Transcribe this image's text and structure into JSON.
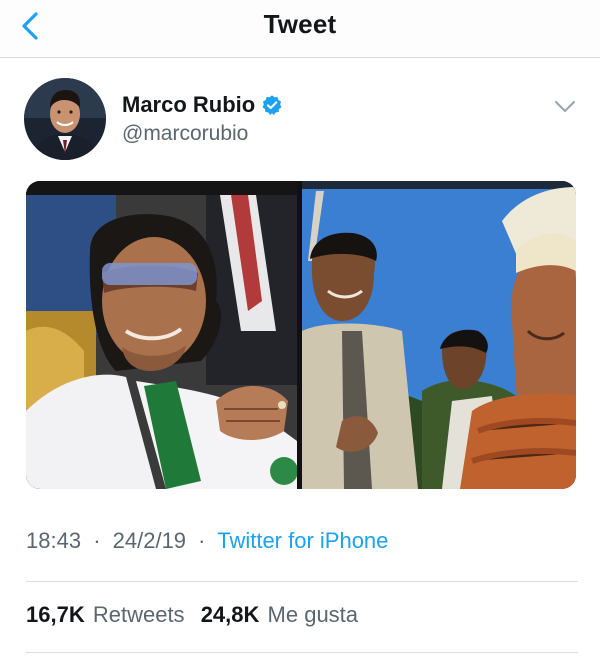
{
  "header": {
    "title": "Tweet",
    "back_icon": "chevron-left-icon",
    "accent": "#1da1f2"
  },
  "author": {
    "display_name": "Marco Rubio",
    "handle": "@marcorubio",
    "verified": true,
    "verified_color": "#1da1f2"
  },
  "tweet": {
    "time": "18:43",
    "date": "24/2/19",
    "separator": "·",
    "source": "Twitter for iPhone",
    "retweets_count": "16,7K",
    "retweets_label": "Retweets",
    "likes_count": "24,8K",
    "likes_label": "Me gusta"
  }
}
